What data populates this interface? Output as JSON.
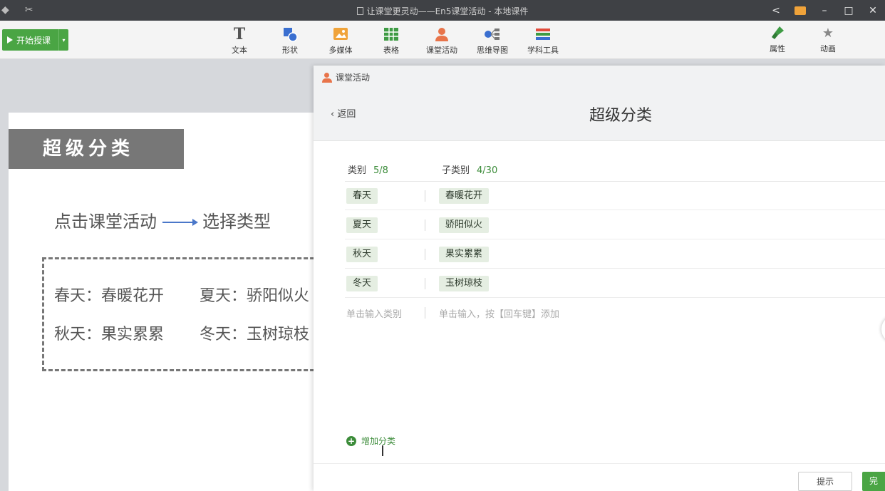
{
  "window": {
    "title": "让课堂更灵动——En5课堂活动 - 本地课件"
  },
  "toolbar": {
    "start_label": "开始授课",
    "tools": [
      {
        "label": "文本",
        "icon": "text-icon"
      },
      {
        "label": "形状",
        "icon": "shape-icon"
      },
      {
        "label": "多媒体",
        "icon": "media-icon"
      },
      {
        "label": "表格",
        "icon": "table-icon"
      },
      {
        "label": "课堂活动",
        "icon": "activity-icon"
      },
      {
        "label": "思维导图",
        "icon": "mindmap-icon"
      },
      {
        "label": "学科工具",
        "icon": "subject-tools-icon"
      }
    ],
    "right_tabs": [
      {
        "label": "属性",
        "icon": "brush-icon"
      },
      {
        "label": "动画",
        "icon": "stars-icon"
      }
    ]
  },
  "slide": {
    "title": "超级分类",
    "instruction_left": "点击课堂活动",
    "instruction_right": "选择类型",
    "pairs_line1_a": "春天：春暖花开",
    "pairs_line1_b": "夏天：骄阳似火",
    "pairs_line2_a": "秋天：果实累累",
    "pairs_line2_b": "冬天：玉树琼枝"
  },
  "modal": {
    "caption": "课堂活动",
    "back_label": "返回",
    "title": "超级分类",
    "category_header": "类别",
    "category_count": "5/8",
    "subcategory_header": "子类别",
    "subcategory_count": "4/30",
    "rows": [
      {
        "category": "春天",
        "sub": "春暖花开"
      },
      {
        "category": "夏天",
        "sub": "骄阳似火"
      },
      {
        "category": "秋天",
        "sub": "果实累累"
      },
      {
        "category": "冬天",
        "sub": "玉树琼枝"
      }
    ],
    "category_placeholder": "单击输入类别",
    "sub_placeholder": "单击输入，按【回车键】添加",
    "add_category_label": "增加分类",
    "hint_label": "提示",
    "done_label": "完"
  },
  "colors": {
    "accent_green": "#4aa544",
    "tag_bg": "#e5eee2",
    "titlebar": "#3f4145"
  }
}
